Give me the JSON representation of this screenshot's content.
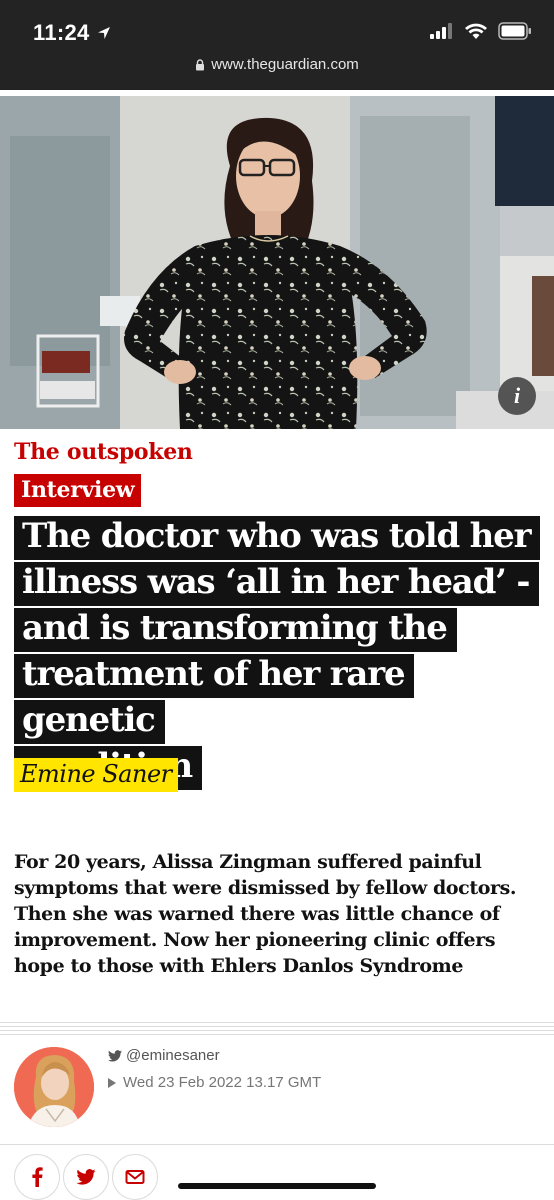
{
  "status_bar": {
    "time": "11:24",
    "url": "www.theguardian.com"
  },
  "hero": {
    "info_label": "i"
  },
  "article": {
    "series": "The outspoken",
    "tag": "Interview",
    "title_lines": [
      "The doctor who was told her",
      "illness was ‘all in her head’ -",
      "and is transforming the",
      "treatment of her rare genetic",
      "condition"
    ],
    "byline": "Emine Saner",
    "standfirst": "For 20 years, Alissa Zingman suffered painful symptoms that were dismissed by fellow doctors. Then she was warned there was little chance of improvement. Now her pioneering clinic offers hope to those with Ehlers Danlos Syndrome"
  },
  "meta": {
    "twitter_handle": "@eminesaner",
    "date": "Wed 23 Feb 2022 13.17 GMT"
  },
  "share": {
    "buttons": [
      "facebook-icon",
      "twitter-icon",
      "email-icon"
    ]
  },
  "colors": {
    "brand_red": "#c70000",
    "headline_bg": "#121212",
    "byline_yellow": "#ffe500",
    "status_bar_bg": "#232323"
  }
}
